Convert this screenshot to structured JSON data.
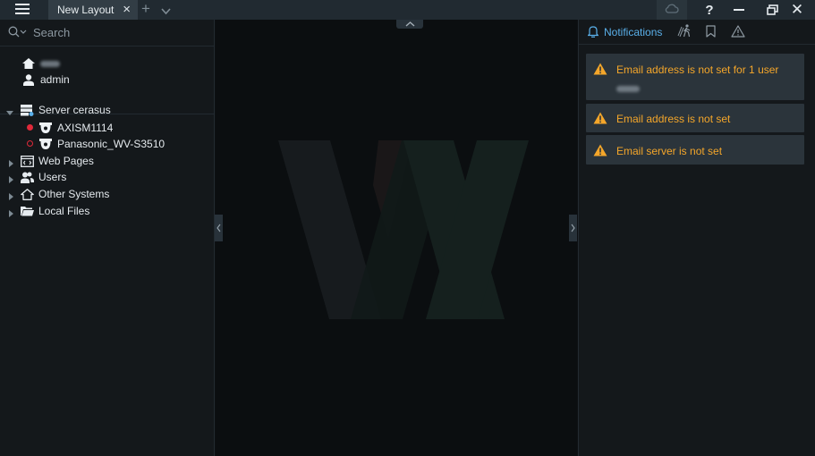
{
  "titlebar": {
    "tab_label": "New Layout",
    "tab_close": "×",
    "tab_add": "+",
    "help": "?",
    "close": "✕"
  },
  "search": {
    "placeholder": "Search"
  },
  "tree": {
    "user": "admin",
    "server": "Server cerasus",
    "camera1": "AXISM1114",
    "camera2": "Panasonic_WV-S3510",
    "web_pages": "Web Pages",
    "users": "Users",
    "other_systems": "Other Systems",
    "local_files": "Local Files"
  },
  "notifications": {
    "tab_label": "Notifications",
    "items": [
      {
        "text": "Email address is not set for 1 user"
      },
      {
        "text": "Email address is not set"
      },
      {
        "text": "Email server is not set"
      }
    ]
  },
  "colors": {
    "accent": "#5ab0ea",
    "warning": "#f4a62a",
    "status_online": "#e0293a",
    "status_offline": "#e0293a"
  },
  "icons": [
    "menu-icon",
    "search-icon",
    "home-icon",
    "user-icon",
    "server-icon",
    "camera-icon",
    "web-pages-icon",
    "users-icon",
    "other-systems-icon",
    "folder-icon",
    "bell-icon",
    "motion-icon",
    "bookmark-icon",
    "warning-icon",
    "cloud-icon"
  ]
}
